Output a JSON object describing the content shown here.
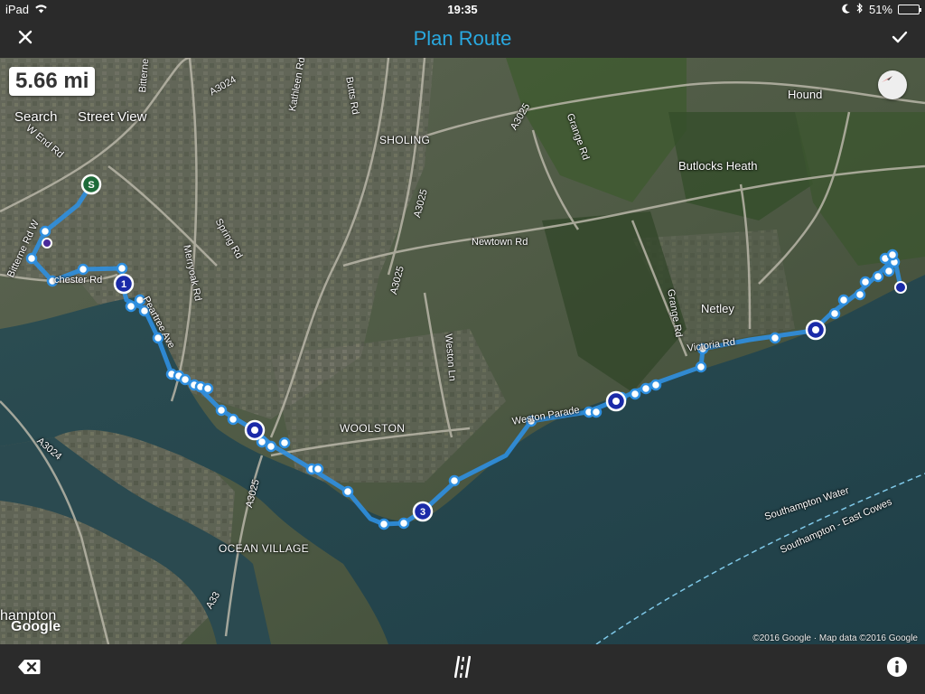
{
  "status_bar": {
    "device": "iPad",
    "time": "19:35",
    "battery_percent": "51%",
    "battery_level": 0.51
  },
  "nav": {
    "title": "Plan Route",
    "close_icon": "close-icon",
    "confirm_icon": "checkmark-icon"
  },
  "map": {
    "distance": "5.66 mi",
    "search_label": "Search",
    "street_view_label": "Street View",
    "google_logo": "Google",
    "attribution": "©2016 Google · Map data ©2016 Google",
    "labels": {
      "sholing": "SHOLING",
      "woolston": "WOOLSTON",
      "ocean_village": "OCEAN VILLAGE",
      "netley": "Netley",
      "butlocks_heath": "Butlocks Heath",
      "hound": "Hound",
      "southampton": "hampton",
      "southampton_water": "Southampton Water",
      "ferry": "Southampton - East Cowes",
      "newtown_rd": "Newtown Rd",
      "grange_rd_1": "Grange Rd",
      "grange_rd_2": "Grange Rd",
      "weston_ln": "Weston Ln",
      "weston_parade": "Weston Parade",
      "victoria_rd": "Victoria Rd",
      "a3025_top": "A3025",
      "a3025_mid": "A3025",
      "a3025_low": "A3025",
      "a3024_top": "A3024",
      "a3024_low": "A3024",
      "kathleen_rd": "Kathleen Rd",
      "butts_rd": "Butts Rd",
      "spring_rd": "Spring Rd",
      "merryoak_rd": "Merryoak Rd",
      "peartree_ave": "Peartree Ave",
      "bitterne": "Bitterne",
      "a33": "A33",
      "westend_rd": "W End Rd",
      "bitterne_rd_w": "Bitterne Rd W",
      "manchester_rd": "chester Rd"
    },
    "markers": {
      "start": "S",
      "waypoint_1": "1",
      "waypoint_3": "3"
    }
  },
  "bottom_bar": {
    "delete_icon": "backspace-icon",
    "road_icon": "road-icon",
    "info_icon": "info-icon"
  },
  "colors": {
    "nav_bg": "#2b2b2b",
    "title": "#29a9e0",
    "route": "#2f8fe0",
    "marker_ring": "#1a2aa8",
    "start_marker": "#1e6b3a"
  }
}
